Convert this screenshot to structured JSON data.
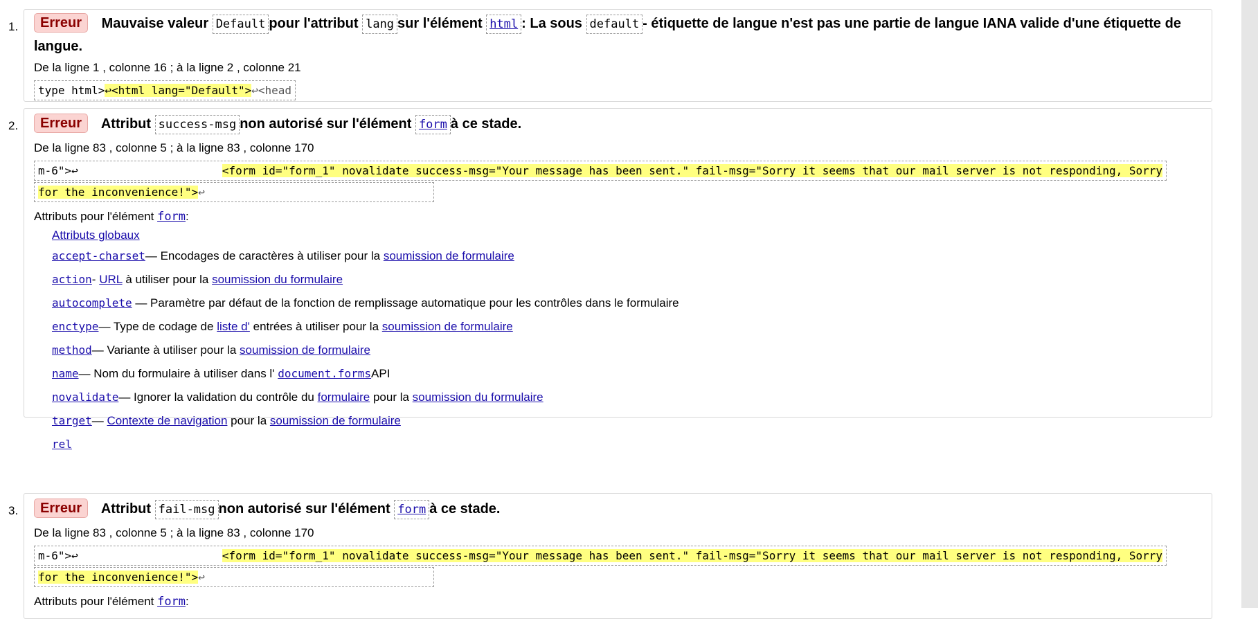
{
  "messages": [
    {
      "number": "1.",
      "badge": "Erreur",
      "text_a": "Mauvaise valeur",
      "code_a": "Default",
      "text_b": "pour l'attribut",
      "code_b": "lang",
      "text_c": "sur l'élément",
      "link_a": "html",
      "text_d": ": La sous",
      "code_c": "default",
      "text_e": "- étiquette de langue n'est pas une partie de langue IANA valide d'une étiquette de langue.",
      "location": "De la ligne 1 , colonne 16 ; à la ligne 2 , colonne 21",
      "extract_pre": "type html>",
      "extract_hl": "↩<html lang=\"Default\">",
      "extract_post": "↩<head"
    },
    {
      "number": "2.",
      "badge": "Erreur",
      "text_a": "Attribut",
      "code_a": "success-msg",
      "text_b": "non autorisé sur l'élément",
      "link_a": "form",
      "text_c": "à ce stade.",
      "location": "De la ligne 83 , colonne 5 ; à la ligne 83 , colonne 170",
      "extract_pre": "m-6\">↩",
      "extract_hl": "<form id=\"form_1\" novalidate success-msg=\"Your message has been sent.\" fail-msg=\"Sorry it seems that our mail server is not responding, Sorry",
      "extract_hl2": "for the inconvenience!\">",
      "extract_post": "↩",
      "attributes_title_prefix": "Attributs pour l'élément",
      "attributes_title_link": "form",
      "attributes_title_suffix": ":",
      "attributes": {
        "global": "Attributs globaux",
        "accept_charset": {
          "name": "accept-charset",
          "pre": "— Encodages de caractères à utiliser pour la",
          "link": "soumission de formulaire"
        },
        "action": {
          "name": "action",
          "dash": "-",
          "link1": "URL",
          "pre": "à utiliser pour la",
          "link2": "soumission du formulaire"
        },
        "autocomplete": {
          "name": "autocomplete",
          "text": "— Paramètre par défaut de la fonction de remplissage automatique pour les contrôles dans le formulaire"
        },
        "enctype": {
          "name": "enctype",
          "pre": "— Type de codage de",
          "link1": "liste d'",
          "mid": "entrées à utiliser pour la",
          "link2": "soumission de formulaire"
        },
        "method": {
          "name": "method",
          "pre": "— Variante à utiliser pour la",
          "link": "soumission de formulaire"
        },
        "name": {
          "name": "name",
          "pre": "— Nom du formulaire à utiliser dans l'",
          "link": "document.forms",
          "post": "API"
        },
        "novalidate": {
          "name": "novalidate",
          "pre": "— Ignorer la validation du contrôle du",
          "link1": "formulaire",
          "mid": "pour la",
          "link2": "soumission du formulaire"
        },
        "target": {
          "name": "target",
          "dash": "—",
          "link1": "Contexte de navigation",
          "mid": "pour la",
          "link2": "soumission de formulaire"
        },
        "rel": {
          "name": "rel"
        }
      }
    },
    {
      "number": "3.",
      "badge": "Erreur",
      "text_a": "Attribut",
      "code_a": "fail-msg",
      "text_b": "non autorisé sur l'élément",
      "link_a": "form",
      "text_c": "à ce stade.",
      "location": "De la ligne 83 , colonne 5 ; à la ligne 83 , colonne 170",
      "extract_pre": "m-6\">↩",
      "extract_hl": "<form id=\"form_1\" novalidate success-msg=\"Your message has been sent.\" fail-msg=\"Sorry it seems that our mail server is not responding, Sorry",
      "extract_hl2": "for the inconvenience!\">",
      "extract_post": "↩",
      "attributes_title_prefix": "Attributs pour l'élément",
      "attributes_title_link": "form",
      "attributes_title_suffix": ":"
    }
  ]
}
